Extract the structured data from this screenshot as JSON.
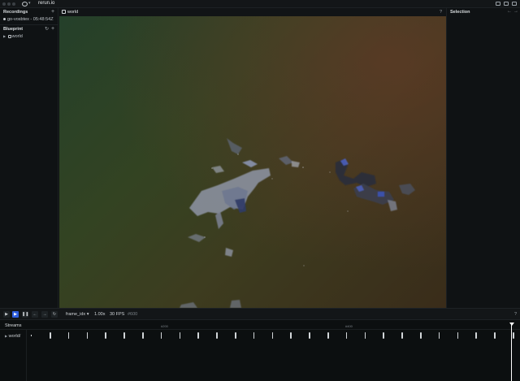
{
  "app": {
    "title": "rerun.io"
  },
  "recordings": {
    "title": "Recordings",
    "add_label": "+",
    "items": [
      "go-vosbtex - 05:48:54Z"
    ]
  },
  "blueprint": {
    "title": "Blueprint",
    "add_label": "+",
    "tree": [
      "world"
    ]
  },
  "viewport": {
    "title": "world",
    "help": "?"
  },
  "selection": {
    "title": "Selection"
  },
  "timeline": {
    "timeline_name": "frame_idx",
    "speed": "1.00x",
    "fps": "30 FPS",
    "current": "#600",
    "help": "?"
  },
  "streams": {
    "title": "Streams",
    "entities": [
      "world/"
    ],
    "ruler_labels": [
      "#200",
      "#400"
    ],
    "event_count": 27
  },
  "colors": {
    "accent": "#2f5fe0",
    "playhead": "#ffffff"
  }
}
